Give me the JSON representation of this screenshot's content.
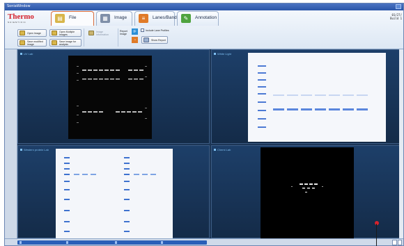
{
  "window": {
    "title": "SoniaWindow"
  },
  "logo": {
    "brand": "Thermo",
    "sub": "SCIENTIFIC"
  },
  "tabs": [
    {
      "label": "File",
      "icon": "folder-icon",
      "color": "#d8b64b"
    },
    {
      "label": "Image",
      "icon": "image-icon",
      "color": "#7f8fa8"
    },
    {
      "label": "Lanes/Bands",
      "icon": "lanes-bands-icon",
      "color": "#e07b28"
    },
    {
      "label": "Annotation",
      "icon": "annotation-icon",
      "color": "#4fa33f"
    }
  ],
  "version": {
    "line1": "01/27/",
    "line2": "Build 1"
  },
  "commands": {
    "open_image": "Open Image",
    "open_multiple": "Open Multiple Images",
    "save_modified": "Save modified image",
    "save_for_analysis": "Save image for analysis",
    "image_information": "Image Information",
    "report_image_title": "Report Image",
    "include_lane_profiles": "Include Lane Profiles",
    "show_report": "Show Report"
  },
  "panes": [
    {
      "label": "UV Lab"
    },
    {
      "label": "White Light"
    },
    {
      "label": "Western protein Lab"
    },
    {
      "label": "Chemi Lab"
    }
  ]
}
